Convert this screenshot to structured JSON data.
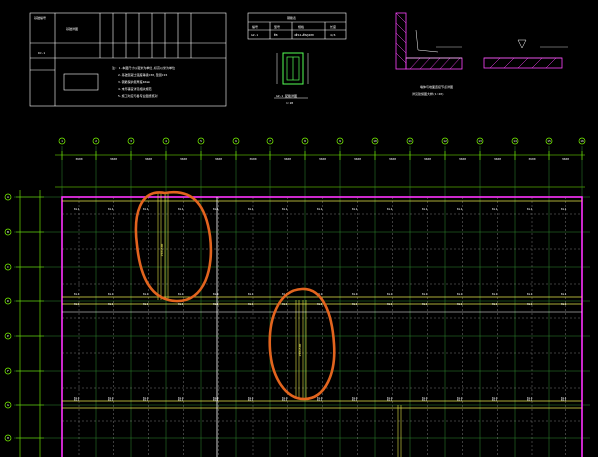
{
  "notes": {
    "table_header_left": "基础编号",
    "table_row_id": "DJ-1",
    "table_row_label": "基础详图",
    "note_lines": [
      "注: 1.本图尺寸以毫米为单位,标高以米为单位",
      "2.基础混凝土强度等级C30,垫层C15",
      "3.钢筋保护层厚度40mm",
      "4.未尽事宜详见相关规范",
      "5.施工时应与各专业图纸核对"
    ]
  },
  "small_table": {
    "title": "钢筋表",
    "cols": [
      "编号",
      "型号",
      "规格",
      "长度"
    ],
    "row": [
      "GZ-1",
      "Φ8",
      "4Φ12+Φ6@200",
      "4/6"
    ]
  },
  "column_detail": {
    "label": "GZ-1 配筋详图",
    "sub": "1:20"
  },
  "section_caption": "墙体与地面连接节点详图",
  "section_sub": "详见建施图大样(1:20)",
  "grid_numbers": [
    "1",
    "2",
    "3",
    "4",
    "5",
    "6",
    "7",
    "8",
    "9",
    "10",
    "11",
    "12",
    "13",
    "14",
    "15",
    "16"
  ],
  "grid_letters": [
    "A",
    "B",
    "C",
    "D",
    "E",
    "F",
    "G",
    "H",
    "J"
  ],
  "beam_label": "KL1",
  "beam_size": "250x500"
}
